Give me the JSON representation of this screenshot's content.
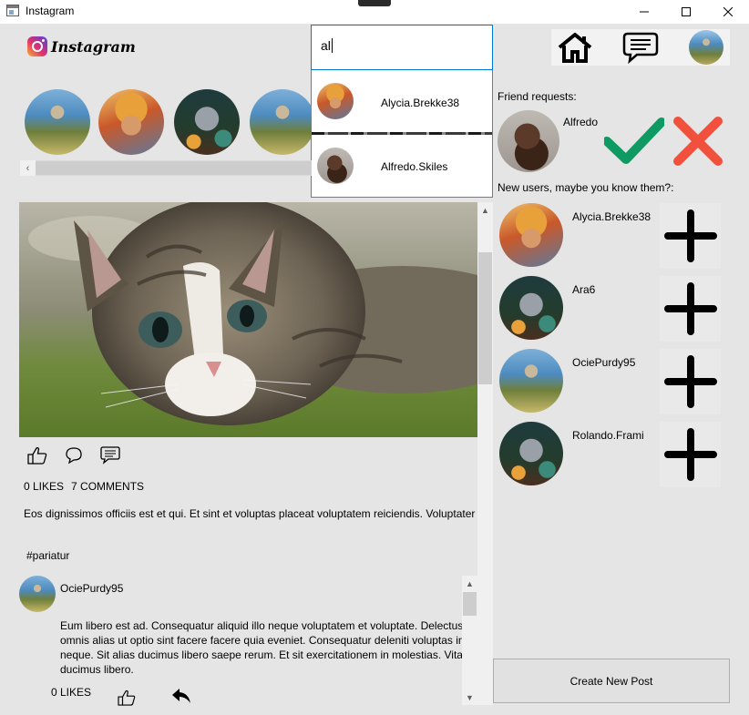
{
  "window": {
    "title": "Instagram"
  },
  "header": {
    "logo_text": "Instagram",
    "search": {
      "value": "al"
    },
    "suggestions": [
      {
        "username": "Alycia.Brekke38",
        "avatar": "autumn-portrait"
      },
      {
        "username": "Alfredo.Skiles",
        "avatar": "dark-portrait"
      }
    ],
    "nav": [
      "home-icon",
      "messages-icon",
      "profile-avatar"
    ]
  },
  "stories": [
    "forest-portrait",
    "autumn-portrait",
    "wolf-illustration",
    "forest-portrait"
  ],
  "post": {
    "image": "kitten-photo",
    "likes_text": "0 LIKES",
    "comments_text": "7 COMMENTS",
    "caption": "Eos dignissimos officiis est et qui. Et sint et voluptas placeat voluptatem reiciendis. Voluptater",
    "tag": "#pariatur",
    "comment": {
      "username": "OciePurdy95",
      "text": "Eum libero est ad. Consequatur aliquid illo neque voluptatem et voluptate. Delectus omnis alias ut optio sint facere facere quia eveniet. Consequatur deleniti voluptas in neque. Sit alias ducimus libero saepe rerum. Et sit exercitationem in molestias. Vitae ducimus libero.",
      "likes_text": "0 LIKES"
    }
  },
  "friend_requests": {
    "label": "Friend requests:",
    "items": [
      {
        "username": "Alfredo"
      }
    ]
  },
  "new_users": {
    "label": "New users, maybe you know them?:",
    "items": [
      {
        "username": "Alycia.Brekke38"
      },
      {
        "username": "Ara6"
      },
      {
        "username": "OciePurdy95"
      },
      {
        "username": "Rolando.Frami"
      }
    ]
  },
  "create_post_label": "Create New Post",
  "colors": {
    "accept": "#0e9a62",
    "reject": "#f0503c",
    "search_border": "#0078d7"
  }
}
